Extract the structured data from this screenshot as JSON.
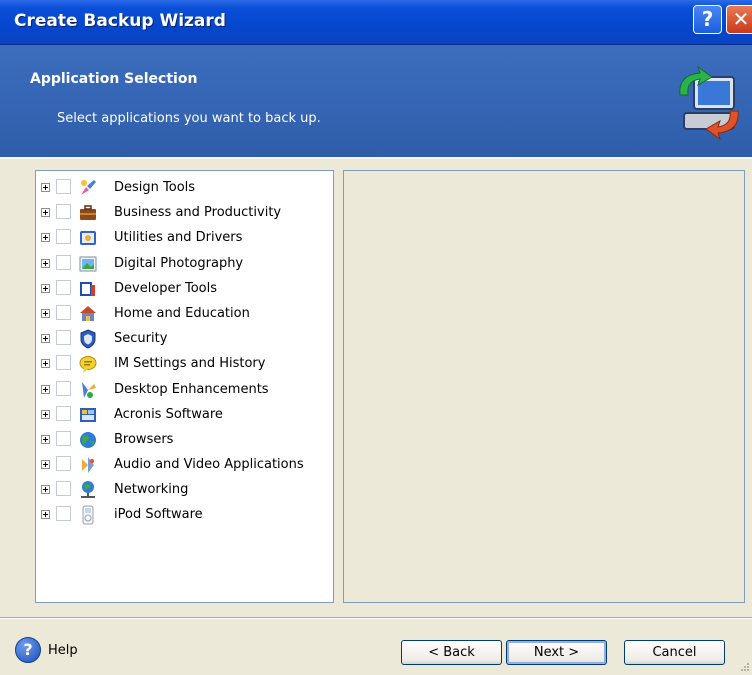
{
  "window": {
    "title": "Create Backup Wizard",
    "help_glyph": "?",
    "close_glyph": "✕"
  },
  "header": {
    "title": "Application Selection",
    "subtitle": "Select applications you want to back up.",
    "icon": "backup-computer-icon"
  },
  "tree": {
    "items": [
      {
        "label": "Design Tools",
        "icon": "design-tools-icon"
      },
      {
        "label": "Business and Productivity",
        "icon": "briefcase-icon"
      },
      {
        "label": "Utilities and Drivers",
        "icon": "utilities-icon"
      },
      {
        "label": "Digital Photography",
        "icon": "photo-icon"
      },
      {
        "label": "Developer Tools",
        "icon": "developer-tools-icon"
      },
      {
        "label": "Home and Education",
        "icon": "home-education-icon"
      },
      {
        "label": "Security",
        "icon": "shield-icon"
      },
      {
        "label": "IM Settings and History",
        "icon": "chat-bubble-icon"
      },
      {
        "label": "Desktop Enhancements",
        "icon": "desktop-enhancements-icon"
      },
      {
        "label": "Acronis Software",
        "icon": "acronis-icon"
      },
      {
        "label": "Browsers",
        "icon": "globe-icon"
      },
      {
        "label": "Audio and Video Applications",
        "icon": "audio-video-icon"
      },
      {
        "label": "Networking",
        "icon": "network-icon"
      },
      {
        "label": "iPod Software",
        "icon": "ipod-icon"
      }
    ]
  },
  "footer": {
    "help_label": "Help",
    "help_glyph": "?",
    "back_label": "< Back",
    "next_label": "Next >",
    "cancel_label": "Cancel"
  },
  "colors": {
    "titlebar": "#0546CE",
    "header": "#3C6EBE",
    "dialog_bg": "#ECE9D8",
    "panel_border": "#7F9DB9"
  }
}
